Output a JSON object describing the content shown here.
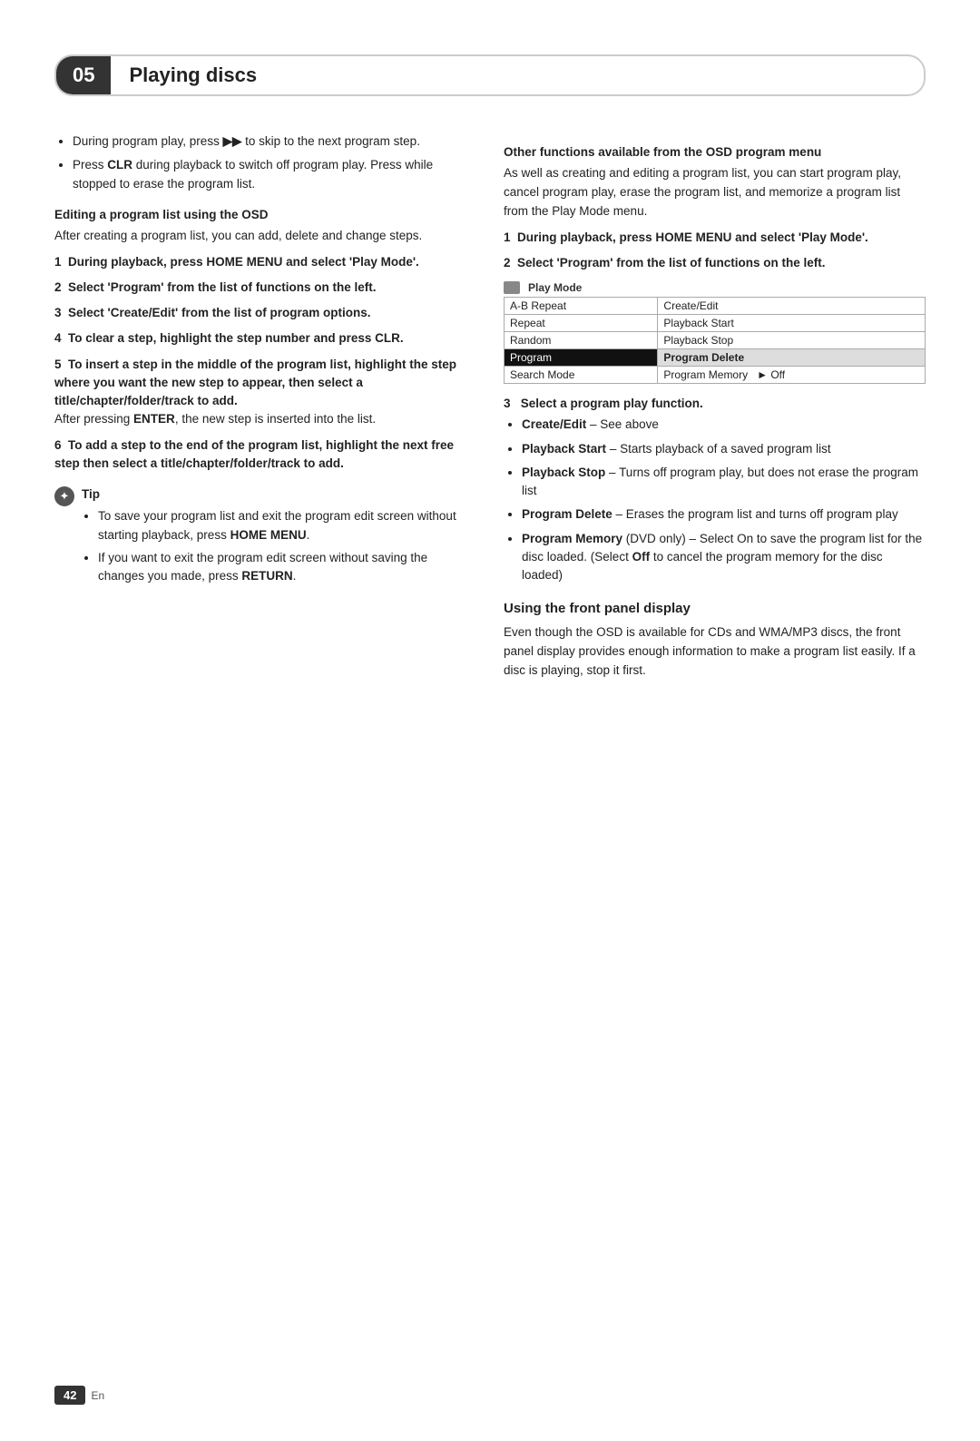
{
  "header": {
    "chapter_number": "05",
    "chapter_title": "Playing discs"
  },
  "left_column": {
    "intro_bullets": [
      "During program play, press ►► to skip to the next program step.",
      "Press CLR during playback to switch off program play. Press while stopped to erase the program list."
    ],
    "editing_section": {
      "heading": "Editing a program list using the OSD",
      "intro": "After creating a program list, you can add, delete and change steps.",
      "steps": [
        {
          "num": "1",
          "text": "During playback, press HOME MENU and select 'Play Mode'."
        },
        {
          "num": "2",
          "text": "Select 'Program' from the list of functions on the left."
        },
        {
          "num": "3",
          "text": "Select 'Create/Edit' from the list of program options."
        },
        {
          "num": "4",
          "text": "To clear a step, highlight the step number and press CLR."
        },
        {
          "num": "5",
          "text": "To insert a step in the middle of the program list, highlight the step where you want the new step to appear, then select a title/chapter/folder/track to add.",
          "after_text": "After pressing ENTER, the new step is inserted into the list."
        },
        {
          "num": "6",
          "text": "To add a step to the end of the program list, highlight the next free step then select a title/chapter/folder/track to add."
        }
      ]
    },
    "tip": {
      "label": "Tip",
      "bullets": [
        "To save your program list and exit the program edit screen without starting playback, press HOME MENU.",
        "If you want to exit the program edit screen without saving the changes you made, press RETURN."
      ]
    }
  },
  "right_column": {
    "other_functions_section": {
      "heading": "Other functions available from the OSD program menu",
      "intro": "As well as creating and editing a program list, you can start program play, cancel program play, erase the program list, and memorize a program list from the Play Mode menu.",
      "steps": [
        {
          "num": "1",
          "text": "During playback, press HOME MENU and select 'Play Mode'."
        },
        {
          "num": "2",
          "text": "Select 'Program' from the list of functions on the left."
        }
      ],
      "osd_table": {
        "title": "Play Mode",
        "rows": [
          {
            "left": "A-B Repeat",
            "right": "Create/Edit",
            "highlighted": false
          },
          {
            "left": "Repeat",
            "right": "Playback Start",
            "highlighted": false
          },
          {
            "left": "Random",
            "right": "Playback Stop",
            "highlighted": false
          },
          {
            "left": "Program",
            "right": "Program Delete",
            "highlighted": true
          },
          {
            "left": "Search Mode",
            "right": "Program Memory",
            "right_extra": "► Off",
            "highlighted": false
          }
        ]
      },
      "step3": {
        "label": "3  Select a program play function.",
        "functions": [
          {
            "name": "Create/Edit",
            "desc": "– See above"
          },
          {
            "name": "Playback Start",
            "desc": "– Starts playback of a saved program list"
          },
          {
            "name": "Playback Stop",
            "desc": "– Turns off program play, but does not erase the program list"
          },
          {
            "name": "Program Delete",
            "desc": "– Erases the program list and turns off program play"
          },
          {
            "name": "Program Memory",
            "desc": "(DVD only) – Select On to save the program list for the disc loaded. (Select Off to cancel the program memory for the disc loaded)"
          }
        ]
      }
    },
    "front_panel_section": {
      "heading": "Using the front panel display",
      "text": "Even though the OSD is available for CDs and WMA/MP3 discs, the front panel display provides enough information to make a program list easily. If a disc is playing, stop it first."
    }
  },
  "footer": {
    "page_number": "42",
    "lang": "En"
  }
}
